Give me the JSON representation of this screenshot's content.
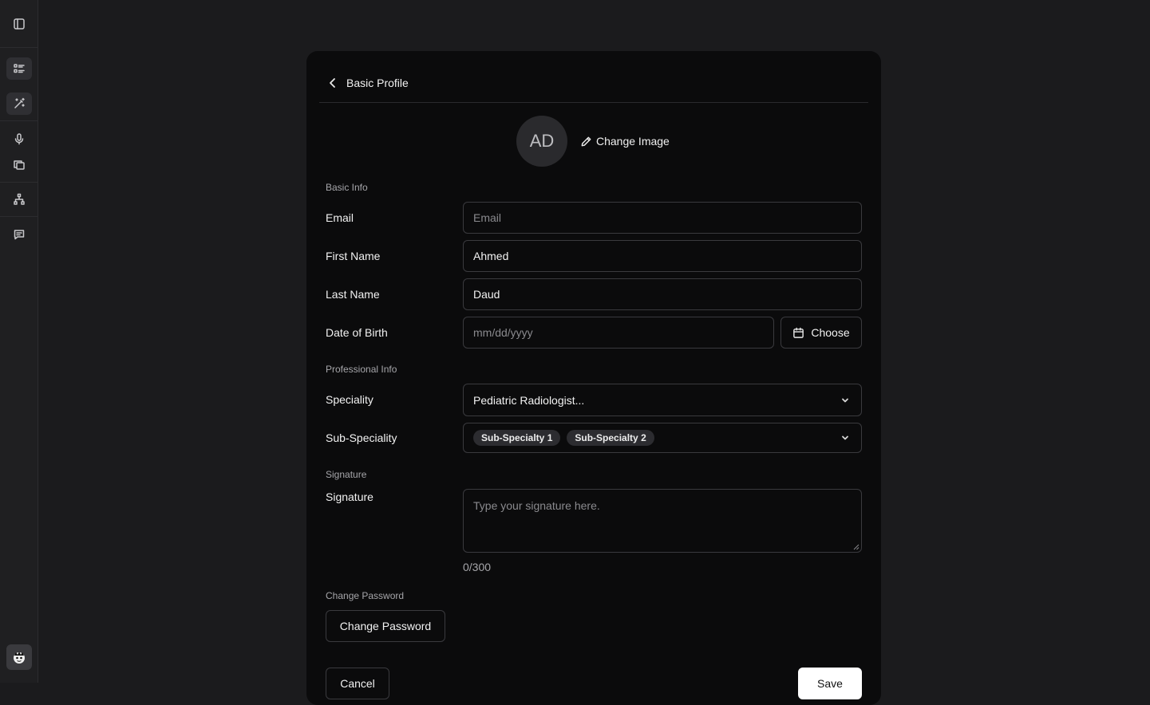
{
  "header": {
    "title": "Basic Profile"
  },
  "avatar": {
    "initials": "AD",
    "change_label": "Change Image"
  },
  "sections": {
    "basic": "Basic Info",
    "professional": "Professional Info",
    "signature": "Signature",
    "password": "Change Password"
  },
  "fields": {
    "email": {
      "label": "Email",
      "placeholder": "Email",
      "value": ""
    },
    "first_name": {
      "label": "First Name",
      "value": "Ahmed"
    },
    "last_name": {
      "label": "Last Name",
      "value": "Daud"
    },
    "dob": {
      "label": "Date of Birth",
      "placeholder": "mm/dd/yyyy",
      "choose_label": "Choose"
    },
    "speciality": {
      "label": "Speciality",
      "value": "Pediatric Radiologist..."
    },
    "sub_speciality": {
      "label": "Sub-Speciality",
      "chips": [
        "Sub-Specialty 1",
        "Sub-Specialty 2"
      ]
    },
    "signature": {
      "label": "Signature",
      "placeholder": "Type your signature here.",
      "counter": "0/300"
    }
  },
  "buttons": {
    "change_password": "Change Password",
    "cancel": "Cancel",
    "save": "Save"
  },
  "icons": [
    "sidebar-toggle-icon",
    "list-icon",
    "magic-wand-icon",
    "microphone-icon",
    "copy-icon",
    "sitemap-icon",
    "message-icon",
    "chevron-left-icon",
    "pencil-icon",
    "calendar-icon",
    "chevron-down-icon"
  ]
}
